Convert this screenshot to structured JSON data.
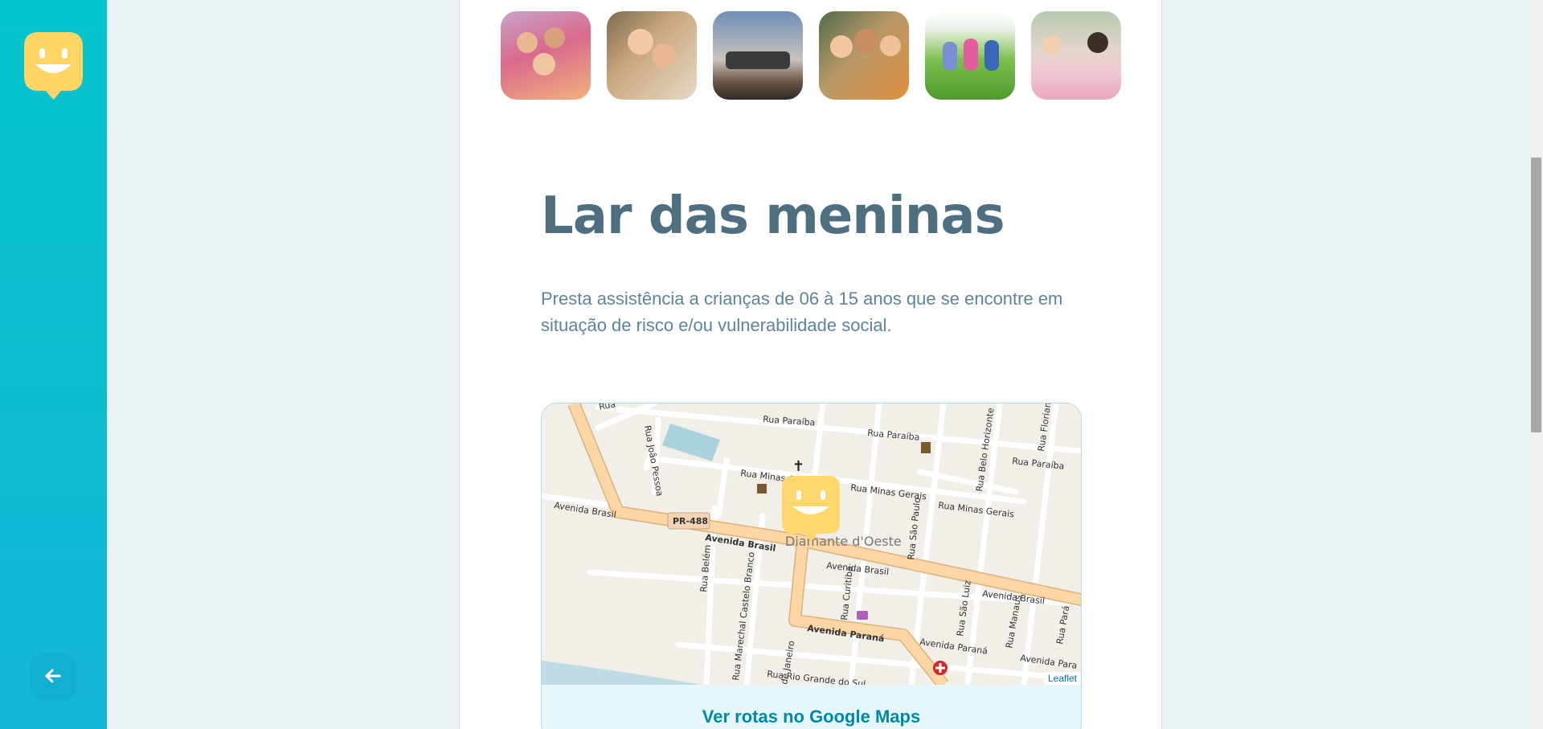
{
  "sidebar": {
    "logo_icon": "smiley-map-marker-icon",
    "back_icon": "arrow-left-icon",
    "accent": "#15c3d6"
  },
  "gallery": {
    "images": [
      {
        "alt": "children-group-photo"
      },
      {
        "alt": "girls-hugging-photo"
      },
      {
        "alt": "kids-jumping-sunset-photo"
      },
      {
        "alt": "toddlers-sitting-photo"
      },
      {
        "alt": "kids-playing-field-photo"
      },
      {
        "alt": "kids-classroom-table-photo"
      }
    ]
  },
  "orphanage": {
    "name": "Lar das meninas",
    "about": "Presta assistência a crianças de 06 à 15 anos que se encontre em situação de risco e/ou vulnerabilidade social."
  },
  "map": {
    "place_label": "Diamante d'Oeste",
    "marker_icon": "smiley-map-marker-icon",
    "attribution": "Leaflet",
    "route_link": "Ver rotas no Google Maps",
    "streets": {
      "s1": "Rua Paraíba",
      "s2": "Rua Paraíba",
      "s3": "Rua Paraíba",
      "s4": "Rua Minas Gerais",
      "s5": "Rua Minas Gerais",
      "s6": "Rua Minas G",
      "s7": "Avenida Brasil",
      "s8": "Avenida Brasil",
      "s9": "Avenida Brasil",
      "s10": "Avenida Brasil",
      "s11": "PR-488",
      "s12": "Avenida Paraná",
      "s13": "Avenida Paraná",
      "s14": "Avenida Para",
      "s15": "Rua João Pessoa",
      "s16": "Rua Belém",
      "s17": "Rua Marechal Castelo Branco",
      "s18": "Rua Curitiba",
      "s19": "Rua São Paulo",
      "s20": "Rua Belo Horizonte",
      "s21": "Rua Floriano",
      "s22": "Rua São Luiz",
      "s23": "Rua Manaus",
      "s24": "Rua Pará",
      "s25": "Rua Rio Grande do Sul",
      "s26": "de Janeiro",
      "s27": "Rua"
    }
  },
  "colors": {
    "title": "#4d6f80",
    "text": "#5c8599",
    "link": "#0089a5",
    "marker": "#ffd666"
  }
}
